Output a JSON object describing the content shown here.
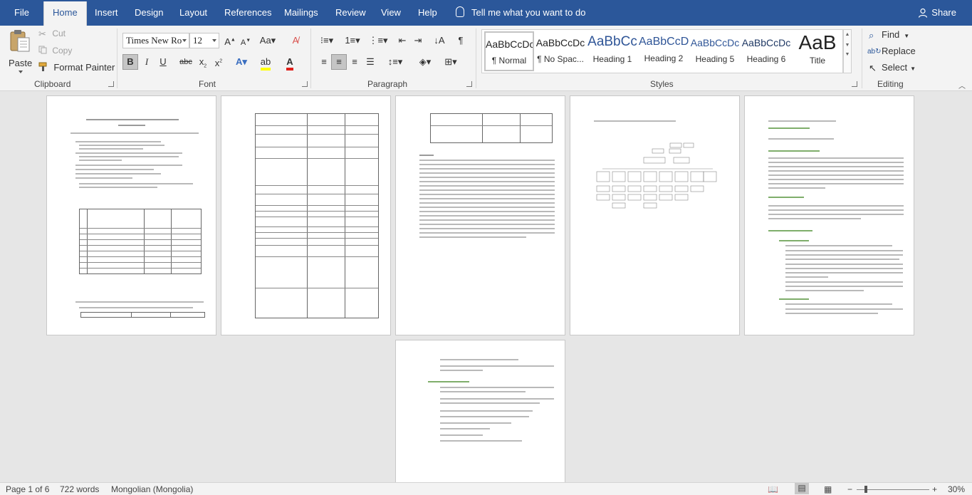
{
  "tabs": [
    {
      "label": "File",
      "active": false
    },
    {
      "label": "Home",
      "active": true
    },
    {
      "label": "Insert",
      "active": false
    },
    {
      "label": "Design",
      "active": false
    },
    {
      "label": "Layout",
      "active": false
    },
    {
      "label": "References",
      "active": false
    },
    {
      "label": "Mailings",
      "active": false
    },
    {
      "label": "Review",
      "active": false
    },
    {
      "label": "View",
      "active": false
    },
    {
      "label": "Help",
      "active": false
    }
  ],
  "tell_me": "Tell me what you want to do",
  "share": "Share",
  "clipboard": {
    "paste": "Paste",
    "cut": "Cut",
    "copy": "Copy",
    "format_painter": "Format Painter",
    "label": "Clipboard"
  },
  "font": {
    "name": "Times New Ro",
    "size": "12",
    "label": "Font"
  },
  "paragraph": {
    "label": "Paragraph"
  },
  "styles": {
    "label": "Styles",
    "items": [
      {
        "preview": "AaBbCcDc",
        "name": "¶ Normal"
      },
      {
        "preview": "AaBbCcDc",
        "name": "¶ No Spac..."
      },
      {
        "preview": "AaBbCc",
        "name": "Heading 1"
      },
      {
        "preview": "AaBbCcD",
        "name": "Heading 2"
      },
      {
        "preview": "AaBbCcDc",
        "name": "Heading 5"
      },
      {
        "preview": "AaBbCcDc",
        "name": "Heading 6"
      },
      {
        "preview": "AaB",
        "name": "Title"
      }
    ]
  },
  "editing": {
    "find": "Find",
    "replace": "Replace",
    "select": "Select",
    "label": "Editing"
  },
  "status": {
    "page": "Page 1 of 6",
    "words": "722 words",
    "language": "Mongolian (Mongolia)",
    "zoom": "30%"
  },
  "colors": {
    "ribbon_blue": "#2b579a",
    "highlight_yellow": "#ffff00",
    "font_red": "#e0201b",
    "heading_green": "#4e9a2a",
    "heading_blue": "#2f5597"
  }
}
